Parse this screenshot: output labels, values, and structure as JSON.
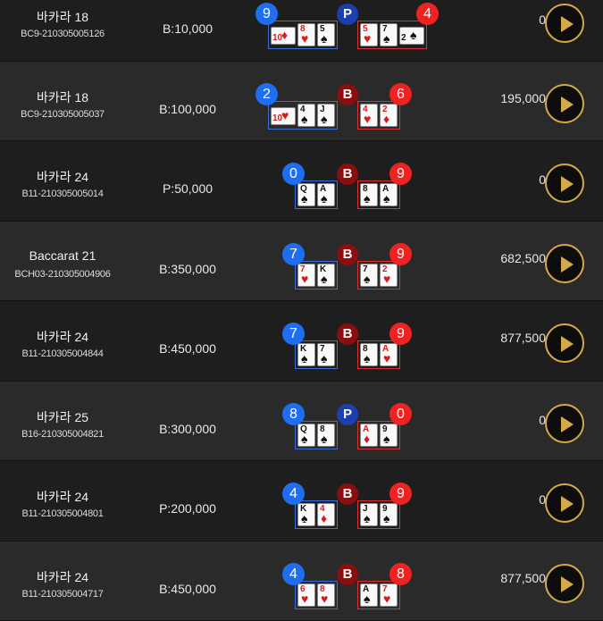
{
  "rows": [
    {
      "game": "바카라 18",
      "round": "BC9-210305005126",
      "bet": "B:10,000",
      "player_score": "9",
      "banker_score": "4",
      "winner": "P",
      "player_cards": [
        {
          "rank": "10",
          "suit": "♦",
          "color": "red",
          "side": true
        },
        {
          "rank": "8",
          "suit": "♥",
          "color": "red"
        },
        {
          "rank": "5",
          "suit": "♠",
          "color": "black"
        }
      ],
      "banker_cards": [
        {
          "rank": "5",
          "suit": "♥",
          "color": "red"
        },
        {
          "rank": "7",
          "suit": "♠",
          "color": "black"
        },
        {
          "rank": "2",
          "suit": "♠",
          "color": "black",
          "side": true
        }
      ],
      "payout": "0"
    },
    {
      "game": "바카라 18",
      "round": "BC9-210305005037",
      "bet": "B:100,000",
      "player_score": "2",
      "banker_score": "6",
      "winner": "B",
      "player_cards": [
        {
          "rank": "10",
          "suit": "♥",
          "color": "red",
          "side": true
        },
        {
          "rank": "4",
          "suit": "♠",
          "color": "black"
        },
        {
          "rank": "J",
          "suit": "♠",
          "color": "black"
        }
      ],
      "banker_cards": [
        {
          "rank": "4",
          "suit": "♥",
          "color": "red"
        },
        {
          "rank": "2",
          "suit": "♦",
          "color": "red"
        }
      ],
      "payout": "195,000"
    },
    {
      "game": "바카라 24",
      "round": "B11-210305005014",
      "bet": "P:50,000",
      "player_score": "0",
      "banker_score": "9",
      "winner": "B",
      "player_cards": [
        {
          "rank": "Q",
          "suit": "♠",
          "color": "black"
        },
        {
          "rank": "A",
          "suit": "♠",
          "color": "black"
        }
      ],
      "banker_cards": [
        {
          "rank": "8",
          "suit": "♠",
          "color": "black"
        },
        {
          "rank": "A",
          "suit": "♠",
          "color": "black"
        }
      ],
      "payout": "0"
    },
    {
      "game": "Baccarat 21",
      "round": "BCH03-210305004906",
      "bet": "B:350,000",
      "player_score": "7",
      "banker_score": "9",
      "winner": "B",
      "player_cards": [
        {
          "rank": "7",
          "suit": "♥",
          "color": "red"
        },
        {
          "rank": "K",
          "suit": "♠",
          "color": "black"
        }
      ],
      "banker_cards": [
        {
          "rank": "7",
          "suit": "♠",
          "color": "black"
        },
        {
          "rank": "2",
          "suit": "♥",
          "color": "red"
        }
      ],
      "payout": "682,500"
    },
    {
      "game": "바카라 24",
      "round": "B11-210305004844",
      "bet": "B:450,000",
      "player_score": "7",
      "banker_score": "9",
      "winner": "B",
      "player_cards": [
        {
          "rank": "K",
          "suit": "♠",
          "color": "black"
        },
        {
          "rank": "7",
          "suit": "♠",
          "color": "black"
        }
      ],
      "banker_cards": [
        {
          "rank": "8",
          "suit": "♠",
          "color": "black"
        },
        {
          "rank": "A",
          "suit": "♥",
          "color": "red"
        }
      ],
      "payout": "877,500"
    },
    {
      "game": "바카라 25",
      "round": "B16-210305004821",
      "bet": "B:300,000",
      "player_score": "8",
      "banker_score": "0",
      "winner": "P",
      "player_cards": [
        {
          "rank": "Q",
          "suit": "♠",
          "color": "black"
        },
        {
          "rank": "8",
          "suit": "♠",
          "color": "black"
        }
      ],
      "banker_cards": [
        {
          "rank": "A",
          "suit": "♦",
          "color": "red"
        },
        {
          "rank": "9",
          "suit": "♠",
          "color": "black"
        }
      ],
      "payout": "0"
    },
    {
      "game": "바카라 24",
      "round": "B11-210305004801",
      "bet": "P:200,000",
      "player_score": "4",
      "banker_score": "9",
      "winner": "B",
      "player_cards": [
        {
          "rank": "K",
          "suit": "♠",
          "color": "black"
        },
        {
          "rank": "4",
          "suit": "♦",
          "color": "red"
        }
      ],
      "banker_cards": [
        {
          "rank": "J",
          "suit": "♠",
          "color": "black"
        },
        {
          "rank": "9",
          "suit": "♠",
          "color": "black"
        }
      ],
      "payout": "0"
    },
    {
      "game": "바카라 24",
      "round": "B11-210305004717",
      "bet": "B:450,000",
      "player_score": "4",
      "banker_score": "8",
      "winner": "B",
      "player_cards": [
        {
          "rank": "6",
          "suit": "♥",
          "color": "red"
        },
        {
          "rank": "8",
          "suit": "♥",
          "color": "red"
        }
      ],
      "banker_cards": [
        {
          "rank": "A",
          "suit": "♠",
          "color": "black"
        },
        {
          "rank": "7",
          "suit": "♥",
          "color": "red"
        }
      ],
      "payout": "877,500"
    }
  ],
  "icons": {
    "play": "play-icon"
  },
  "colors": {
    "player": "#1f6ef0",
    "banker": "#ef2222",
    "accent_gold": "#d4a94a"
  }
}
